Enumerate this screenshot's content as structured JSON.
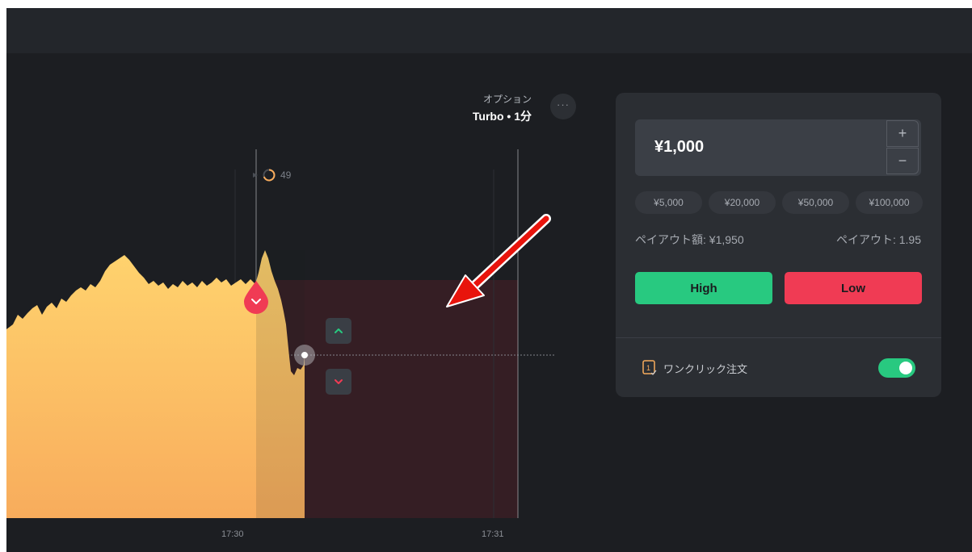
{
  "chart": {
    "option_label": "オプション",
    "option_value": "Turbo • 1分",
    "more_label": "···",
    "timer_value": "49",
    "x_ticks": [
      "17:30",
      "17:31"
    ]
  },
  "trade_panel": {
    "amount": "¥1,000",
    "plus_label": "+",
    "minus_label": "−",
    "presets": [
      "¥5,000",
      "¥20,000",
      "¥50,000",
      "¥100,000"
    ],
    "payout_amount": "ペイアウト額: ¥1,950",
    "payout_rate": "ペイアウト: 1.95",
    "high_label": "High",
    "low_label": "Low",
    "oneclick_label": "ワンクリック注文",
    "oneclick_enabled": true
  },
  "colors": {
    "high": "#28c980",
    "low": "#f03b54",
    "area_top": "#ffd36e",
    "area_bottom": "#f8ac5c",
    "annotation_arrow": "#e8140c"
  }
}
